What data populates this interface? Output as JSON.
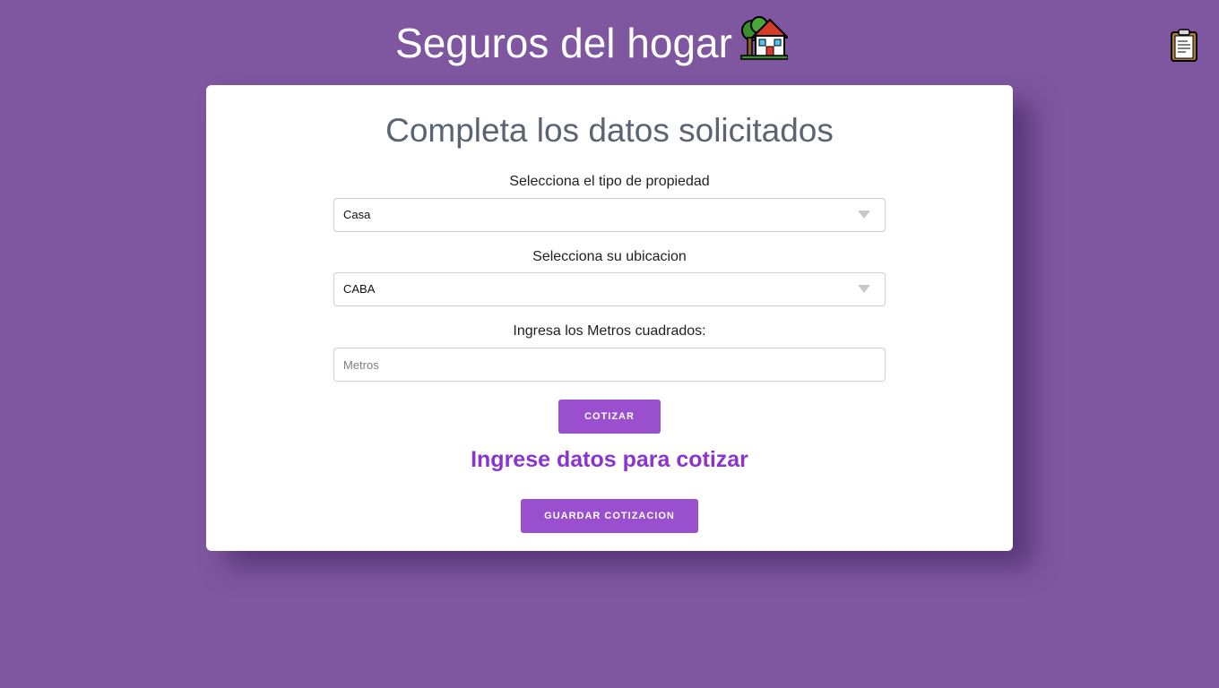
{
  "header": {
    "title": "Seguros del hogar",
    "title_icon": "house-with-garden-icon",
    "clipboard_icon": "clipboard-icon"
  },
  "form": {
    "heading": "Completa los datos solicitados",
    "property_type": {
      "label": "Selecciona el tipo de propiedad",
      "value": "Casa"
    },
    "location": {
      "label": "Selecciona su ubicacion",
      "value": "CABA"
    },
    "square_meters": {
      "label": "Ingresa los Metros cuadrados:",
      "placeholder": "Metros",
      "value": ""
    },
    "quote_button": "COTIZAR",
    "result_text": "Ingrese datos para cotizar",
    "save_button": "GUARDAR COTIZACION"
  },
  "colors": {
    "background": "#7e57a0",
    "accent": "#9a4fcf",
    "result_text": "#8a35d0"
  }
}
